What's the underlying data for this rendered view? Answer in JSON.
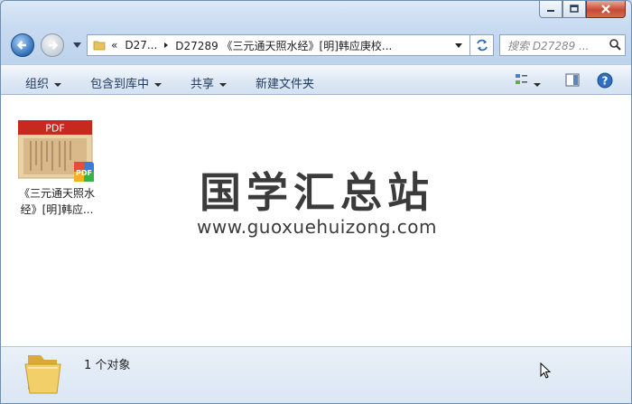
{
  "window": {
    "caption_buttons": [
      "minimize",
      "maximize",
      "close"
    ]
  },
  "nav": {
    "address_parts": [
      "«",
      "D27...",
      "D27289 《三元通天照水经》[明]韩应庚校..."
    ],
    "search_placeholder": "搜索 D27289 ..."
  },
  "toolbar": {
    "organize": "组织",
    "include_in_library": "包含到库中",
    "share": "共享",
    "new_folder": "新建文件夹"
  },
  "content": {
    "file": {
      "icon_label": "PDF",
      "badge_label": "PDF",
      "name_line1": "《三元通天照水",
      "name_line2": "经》[明]韩应..."
    },
    "watermark_title": "国学汇总站",
    "watermark_url": "www.guoxuehuizong.com"
  },
  "details": {
    "count": "1 个对象"
  }
}
